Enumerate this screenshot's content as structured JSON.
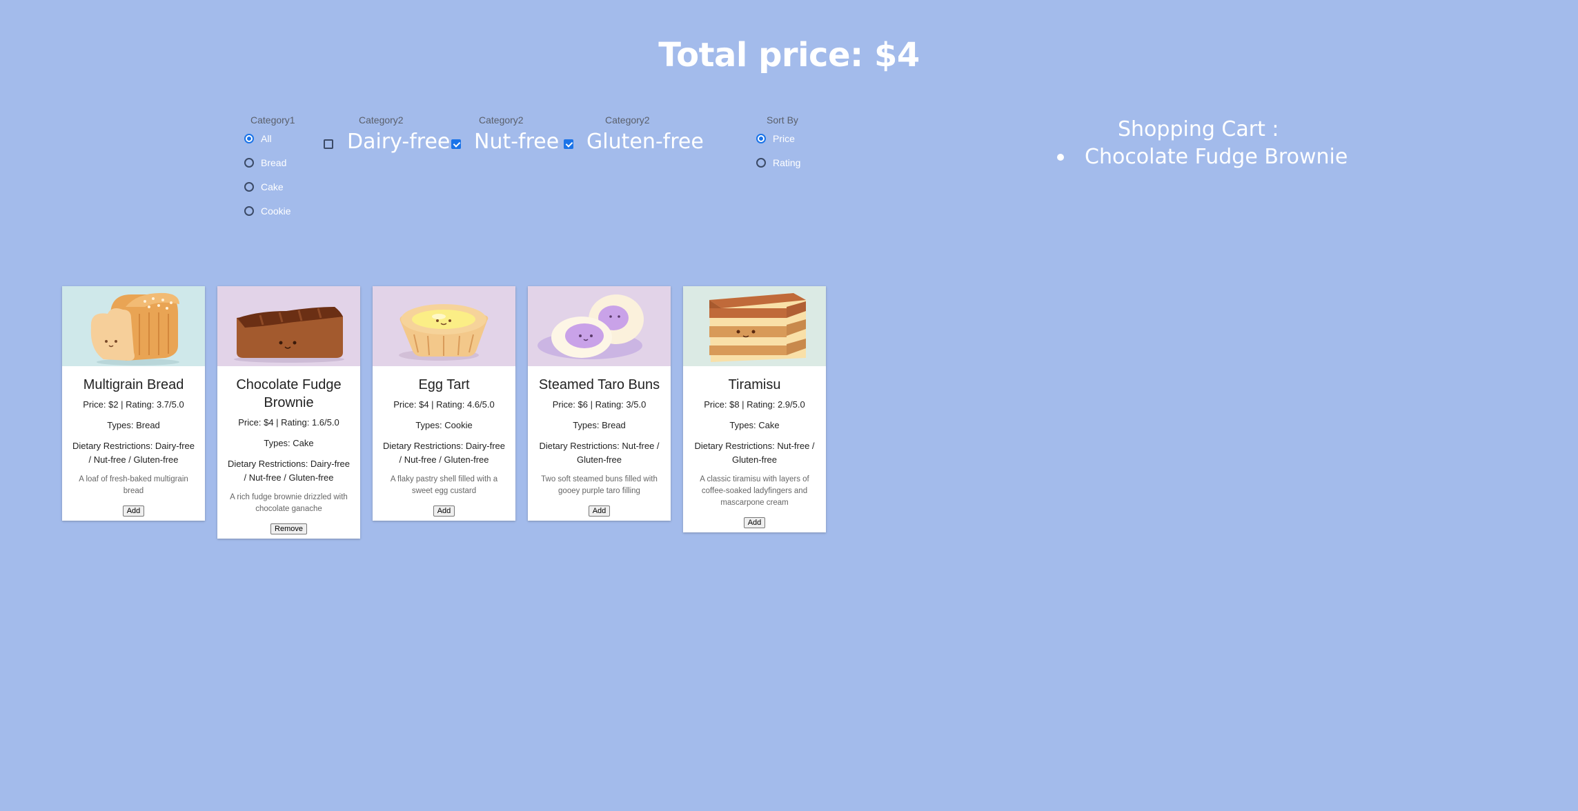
{
  "header": {
    "title": "Total price: $4"
  },
  "filters": {
    "category1": {
      "label": "Category1",
      "options": [
        "All",
        "Bread",
        "Cake",
        "Cookie"
      ],
      "selected": "All"
    },
    "category2": [
      {
        "label": "Category2",
        "option": "Dairy-free",
        "checked": false
      },
      {
        "label": "Category2",
        "option": "Nut-free",
        "checked": true
      },
      {
        "label": "Category2",
        "option": "Gluten-free",
        "checked": true
      }
    ],
    "sort": {
      "label": "Sort By",
      "options": [
        "Price",
        "Rating"
      ],
      "selected": "Price"
    }
  },
  "cart": {
    "title": "Shopping Cart :",
    "items": [
      "Chocolate Fudge Brownie"
    ]
  },
  "products": [
    {
      "name": "Multigrain Bread",
      "price_rating": "Price: $2 | Rating: 3.7/5.0",
      "types": "Types: Bread",
      "diet": "Dietary Restrictions: Dairy-free / Nut-free / Gluten-free",
      "desc": "A loaf of fresh-baked multigrain bread",
      "button": "Add",
      "image": "bread-loaf-icon",
      "bg": "#cfe8ea"
    },
    {
      "name": "Chocolate Fudge Brownie",
      "price_rating": "Price: $4 | Rating: 1.6/5.0",
      "types": "Types: Cake",
      "diet": "Dietary Restrictions: Dairy-free / Nut-free / Gluten-free",
      "desc": "A rich fudge brownie drizzled with chocolate ganache",
      "button": "Remove",
      "image": "brownie-icon",
      "bg": "#e2d3e8"
    },
    {
      "name": "Egg Tart",
      "price_rating": "Price: $4 | Rating: 4.6/5.0",
      "types": "Types: Cookie",
      "diet": "Dietary Restrictions: Dairy-free / Nut-free / Gluten-free",
      "desc": "A flaky pastry shell filled with a sweet egg custard",
      "button": "Add",
      "image": "egg-tart-icon",
      "bg": "#e2d3e8"
    },
    {
      "name": "Steamed Taro Buns",
      "price_rating": "Price: $6 | Rating: 3/5.0",
      "types": "Types: Bread",
      "diet": "Dietary Restrictions: Nut-free / Gluten-free",
      "desc": "Two soft steamed buns filled with gooey purple taro filling",
      "button": "Add",
      "image": "taro-bun-icon",
      "bg": "#e2d3e8"
    },
    {
      "name": "Tiramisu",
      "price_rating": "Price: $8 | Rating: 2.9/5.0",
      "types": "Types: Cake",
      "diet": "Dietary Restrictions: Nut-free / Gluten-free",
      "desc": "A classic tiramisu with layers of coffee-soaked ladyfingers and mascarpone cream",
      "button": "Add",
      "image": "tiramisu-icon",
      "bg": "#dbeae4"
    }
  ],
  "colors": {
    "background": "#a3bbeb",
    "accent": "#1a73e8",
    "card": "#ffffff"
  }
}
